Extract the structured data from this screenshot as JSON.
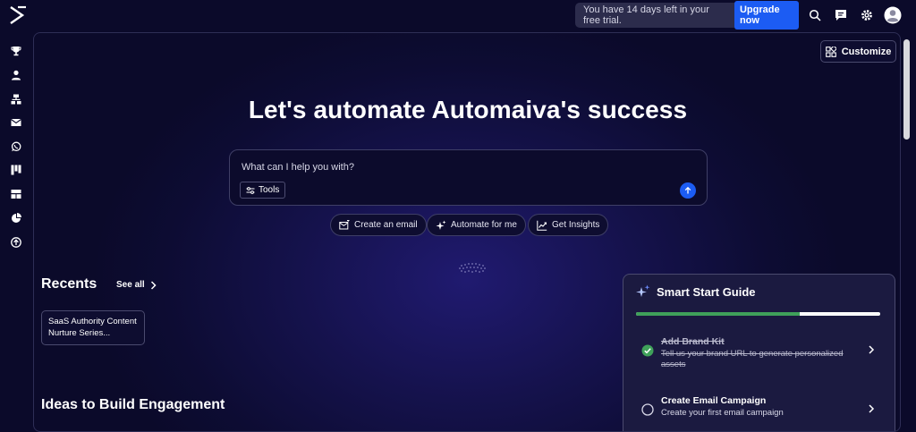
{
  "topbar": {
    "trial_text": "You have 14 days left in your free trial.",
    "upgrade_label": "Upgrade now",
    "icons": [
      "logo-icon",
      "search-icon",
      "chat-icon",
      "gear-icon",
      "avatar-icon"
    ]
  },
  "sidebar": {
    "items": [
      "trophy-icon",
      "person-icon",
      "org-chart-icon",
      "mail-icon",
      "whatsapp-icon",
      "kanban-icon",
      "template-icon",
      "pie-chart-icon",
      "upload-icon"
    ]
  },
  "main": {
    "customize_label": "Customize",
    "hero_title": "Let's automate Automaiva's success",
    "prompt_placeholder": "What can I help you with?",
    "tools_label": "Tools",
    "chips": [
      "Create an email",
      "Automate for me",
      "Get Insights"
    ],
    "recents_title": "Recents",
    "see_all_label": "See all",
    "recent_items": [
      "SaaS Authority Content Nurture Series..."
    ],
    "ideas_title": "Ideas to Build Engagement"
  },
  "guide": {
    "title": "Smart Start Guide",
    "progress_fraction": 0.67,
    "tasks": [
      {
        "title": "Add Brand Kit",
        "desc": "Tell us your brand URL to generate personalized assets",
        "done": true
      },
      {
        "title": "Create Email Campaign",
        "desc": "Create your first email campaign",
        "done": false
      }
    ]
  },
  "colors": {
    "accent": "#1c5cf3",
    "success": "#3fa15a",
    "background": "#0b0a2a"
  }
}
